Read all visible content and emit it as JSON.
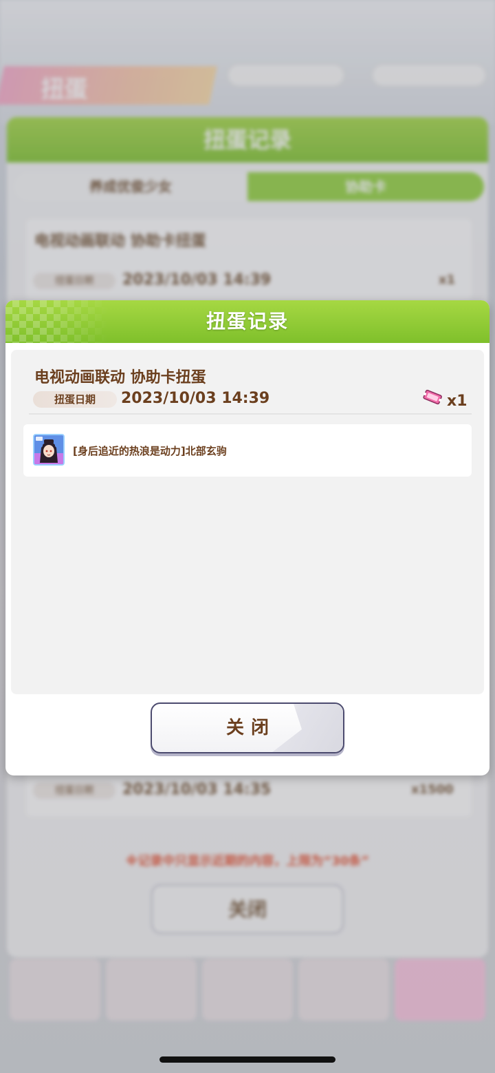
{
  "background": {
    "banner_text": "扭蛋",
    "outer_title": "扭蛋记录",
    "tabs": [
      {
        "label": "养成优俊少女"
      },
      {
        "label": "协助卡"
      }
    ],
    "record_1": {
      "title": "电视动画联动  协助卡扭蛋",
      "date_label": "扭蛋日期",
      "date_value": "2023/10/03  14:39",
      "count": "x1"
    },
    "record_2": {
      "date_label": "扭蛋日期",
      "date_value": "2023/10/03  14:35",
      "count": "x1500"
    },
    "note": "※记录中只显示近期的内容，上限为“30条”",
    "close_label": "关闭"
  },
  "dialog": {
    "title": "扭蛋记录",
    "record": {
      "title": "电视动画联动  协助卡扭蛋",
      "date_label": "扭蛋日期",
      "date_value": "2023/10/03  14:39",
      "ticket_count": "x1",
      "ticket_icon": "ticket-icon"
    },
    "items": [
      {
        "name": "[身后追近的热浪是动力]北部玄驹",
        "icon": "support-card-thumbnail"
      }
    ],
    "close_label": "关闭"
  },
  "colors": {
    "header_green": "#7fc02b",
    "text_brown": "#6b3f1e",
    "ticket_pink": "#f06aa8"
  }
}
